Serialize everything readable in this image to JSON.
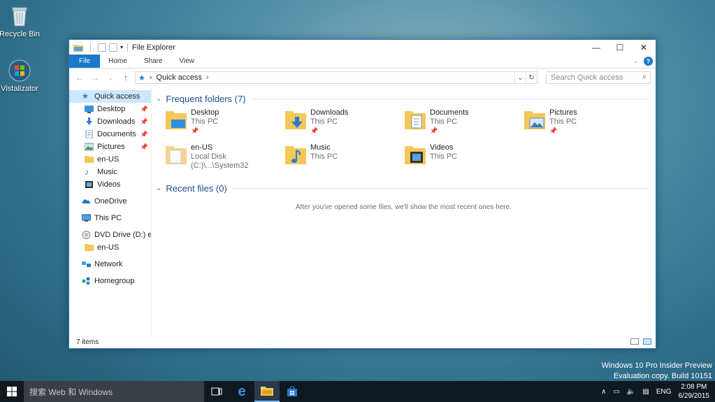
{
  "desktop": {
    "icons": [
      {
        "label": "Recycle Bin"
      },
      {
        "label": "Vistalizator"
      }
    ],
    "watermark": {
      "line1": "Windows 10 Pro Insider Preview",
      "line2": "Evaluation copy. Build 10151"
    }
  },
  "window": {
    "title": "File Explorer",
    "ribbon": {
      "tabs": [
        "File",
        "Home",
        "Share",
        "View"
      ]
    },
    "address": {
      "path": "Quick access"
    },
    "search": {
      "placeholder": "Search Quick access"
    },
    "nav": {
      "quick_access": "Quick access",
      "pinned": [
        {
          "label": "Desktop"
        },
        {
          "label": "Downloads"
        },
        {
          "label": "Documents"
        },
        {
          "label": "Pictures"
        }
      ],
      "recent": [
        {
          "label": "en-US"
        },
        {
          "label": "Music"
        },
        {
          "label": "Videos"
        }
      ],
      "onedrive": "OneDrive",
      "this_pc": "This PC",
      "dvd": "DVD Drive (D:) en-U",
      "dvd_child": "en-US",
      "network": "Network",
      "homegroup": "Homegroup"
    },
    "frequent": {
      "heading": "Frequent folders (7)",
      "items": [
        {
          "name": "Desktop",
          "location": "This PC",
          "pinned": true
        },
        {
          "name": "Downloads",
          "location": "This PC",
          "pinned": true
        },
        {
          "name": "Documents",
          "location": "This PC",
          "pinned": true
        },
        {
          "name": "Pictures",
          "location": "This PC",
          "pinned": true
        },
        {
          "name": "en-US",
          "location": "Local Disk (C:)\\...\\System32",
          "pinned": false
        },
        {
          "name": "Music",
          "location": "This PC",
          "pinned": false
        },
        {
          "name": "Videos",
          "location": "This PC",
          "pinned": false
        }
      ]
    },
    "recent_files": {
      "heading": "Recent files (0)",
      "empty_message": "After you've opened some files, we'll show the most recent ones here."
    },
    "status": {
      "items": "7 items"
    }
  },
  "taskbar": {
    "search_placeholder": "搜索 Web 和 Windows",
    "language": "ENG",
    "time": "2:08 PM",
    "date": "6/29/2015"
  },
  "colors": {
    "accent": "#1979ca",
    "selection": "#cce8ff",
    "folder": "#f3c758"
  }
}
